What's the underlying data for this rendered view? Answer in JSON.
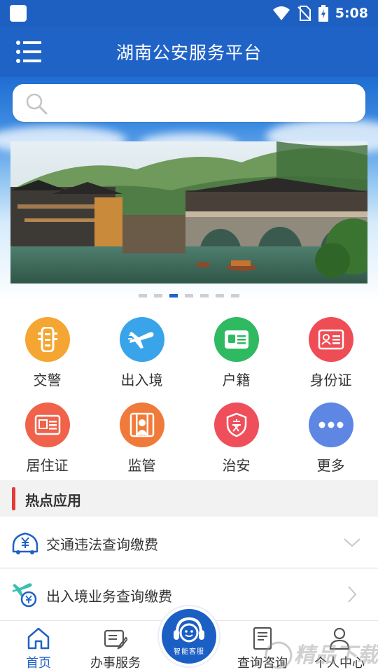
{
  "status_bar": {
    "time": "5:08"
  },
  "header": {
    "title": "湖南公安服务平台"
  },
  "search": {
    "placeholder": ""
  },
  "banner": {
    "dots_count": 7,
    "active_dot": 3
  },
  "grid": {
    "items": [
      {
        "label": "交警",
        "color": "#f5a531",
        "icon": "traffic-light-icon"
      },
      {
        "label": "出入境",
        "color": "#3aa4ea",
        "icon": "airplane-icon"
      },
      {
        "label": "户籍",
        "color": "#2fba62",
        "icon": "id-card-icon"
      },
      {
        "label": "身份证",
        "color": "#ee4d55",
        "icon": "identity-card-icon"
      },
      {
        "label": "居住证",
        "color": "#f0624a",
        "icon": "residence-card-icon"
      },
      {
        "label": "监管",
        "color": "#f07a3a",
        "icon": "prison-icon"
      },
      {
        "label": "治安",
        "color": "#ef4f5b",
        "icon": "police-shield-icon"
      },
      {
        "label": "更多",
        "color": "#5e87e4",
        "icon": "more-icon"
      }
    ]
  },
  "hot_apps": {
    "title": "热点应用",
    "items": [
      {
        "label": "交通违法查询缴费",
        "icon": "car-payment-icon",
        "arrow": "chevron-down-icon"
      },
      {
        "label": "出入境业务查询缴费",
        "icon": "plane-payment-icon",
        "arrow": "chevron-right-icon"
      }
    ]
  },
  "bottom_nav": {
    "items": [
      {
        "label": "首页",
        "icon": "home-icon"
      },
      {
        "label": "办事服务",
        "icon": "service-form-icon"
      },
      {
        "label": "查询咨询",
        "icon": "query-document-icon"
      },
      {
        "label": "个人中心",
        "icon": "user-icon"
      }
    ],
    "center_label": "智能客服"
  },
  "colors": {
    "primary": "#2063c7",
    "accent": "#e53935"
  },
  "watermark": {
    "text": "精品下载"
  }
}
